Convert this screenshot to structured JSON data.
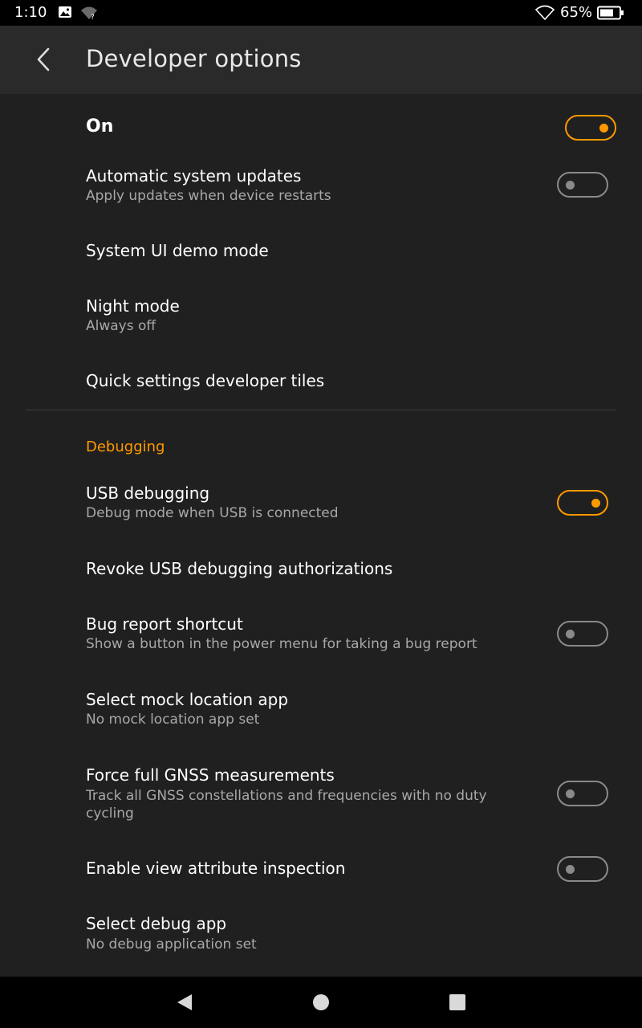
{
  "status_bar": {
    "time": "1:10",
    "battery_percent": "65%",
    "icons": [
      "image-icon",
      "wifi-unknown-icon",
      "wifi-icon",
      "battery-icon"
    ]
  },
  "app_bar": {
    "title": "Developer options",
    "back_icon": "chevron-left-icon"
  },
  "master_switch": {
    "label": "On",
    "state": "on"
  },
  "settings": {
    "auto_updates": {
      "title": "Automatic system updates",
      "subtitle": "Apply updates when device restarts",
      "toggle": "off"
    },
    "demo_mode": {
      "title": "System UI demo mode"
    },
    "night_mode": {
      "title": "Night mode",
      "subtitle": "Always off"
    },
    "qs_tiles": {
      "title": "Quick settings developer tiles"
    }
  },
  "debugging": {
    "header": "Debugging",
    "usb_debugging": {
      "title": "USB debugging",
      "subtitle": "Debug mode when USB is connected",
      "toggle": "on"
    },
    "revoke_usb": {
      "title": "Revoke USB debugging authorizations"
    },
    "bug_report": {
      "title": "Bug report shortcut",
      "subtitle": "Show a button in the power menu for taking a bug report",
      "toggle": "off"
    },
    "mock_location": {
      "title": "Select mock location app",
      "subtitle": "No mock location app set"
    },
    "gnss": {
      "title": "Force full GNSS measurements",
      "subtitle": "Track all GNSS constellations and frequencies with no duty cycling",
      "toggle": "off"
    },
    "view_attr": {
      "title": "Enable view attribute inspection",
      "toggle": "off"
    },
    "debug_app": {
      "title": "Select debug app",
      "subtitle": "No debug application set"
    }
  },
  "nav_bar": {
    "icons": [
      "back-triangle-icon",
      "home-circle-icon",
      "recents-square-icon"
    ]
  },
  "colors": {
    "accent": "#ff9900",
    "background": "#202020",
    "app_bar": "#2a2a2a",
    "toggle_off": "#8a8a8a",
    "subtitle": "#a8a8a8"
  }
}
